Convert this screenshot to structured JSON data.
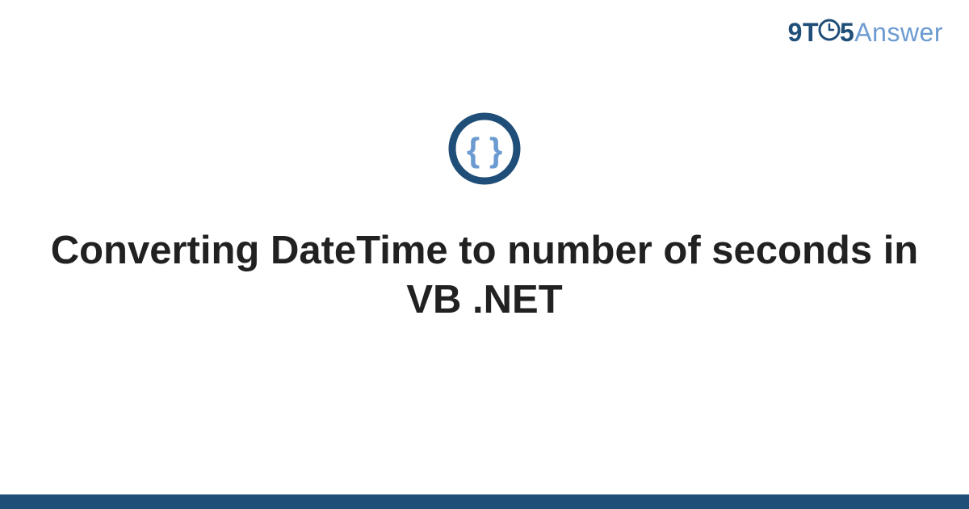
{
  "logo": {
    "part1": "9T",
    "part2": "5",
    "part3": "Answer"
  },
  "title": "Converting DateTime to number of seconds in VB .NET",
  "colors": {
    "brandDark": "#1f4e79",
    "brandLight": "#6b9bd1"
  }
}
